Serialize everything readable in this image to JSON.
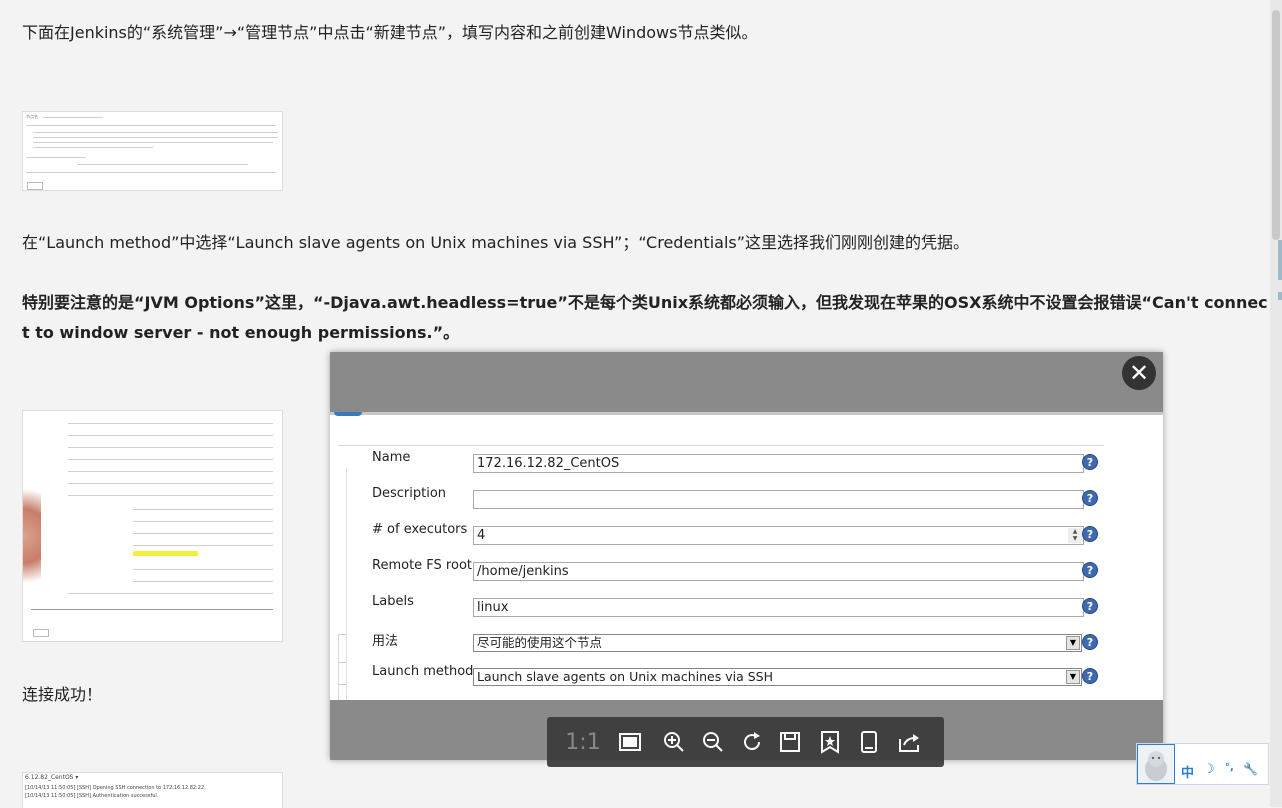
{
  "article": {
    "para1": "下面在Jenkins的“系统管理”→“管理节点”中点击“新建节点”，填写内容和之前创建Windows节点类似。",
    "para2": "在“Launch method”中选择“Launch slave agents on Unix machines via SSH”；“Credentials”这里选择我们刚刚创建的凭据。",
    "para3_line1": "特别要注意的是“JVM Options”这里，“-Djava.awt.headless=true”不是每个类Unix系统都必须输入，但我发现在苹果的OSX系统中不设置会报错误“Can't connec",
    "para3_line2": "t to window server - not enough permissions.”。",
    "para4": "连接成功！",
    "thumb3_title": "6.12.82_CentOS ▾",
    "thumb3_log1": "[10/14/13 11:50:05] [SSH] Opening SSH connection to 172.16.12.82:22.",
    "thumb3_log2": "[10/14/13 11:50:05] [SSH] Authentication successful."
  },
  "viewer": {
    "close_glyph": "✕",
    "form": {
      "name_label": "Name",
      "name_value": "172.16.12.82_CentOS",
      "description_label": "Description",
      "description_value": "",
      "executors_label": "# of executors",
      "executors_value": "4",
      "remote_fs_label": "Remote FS root",
      "remote_fs_value": "/home/jenkins",
      "labels_label": "Labels",
      "labels_value": "linux",
      "usage_label": "用法",
      "usage_value": "尽可能的使用这个节点",
      "launch_label": "Launch method",
      "launch_value": "Launch slave agents on Unix machines via SSH",
      "help_glyph": "?"
    },
    "toolbar": {
      "ratio_label": "1:1",
      "icons": [
        "fit-screen-icon",
        "zoom-in-icon",
        "zoom-out-icon",
        "rotate-icon",
        "save-icon",
        "bookmark-icon",
        "mobile-icon",
        "share-icon"
      ]
    }
  },
  "ime": {
    "lang": "中",
    "mode_glyph": "☽",
    "punct": "°,",
    "tool_glyph": "🔧"
  },
  "colors": {
    "help_blue": "#3f6ab0",
    "overlay_gray": "#8a8a8a",
    "toolbar_dark": "#3d3d3d",
    "ime_blue": "#2a7fd4"
  }
}
